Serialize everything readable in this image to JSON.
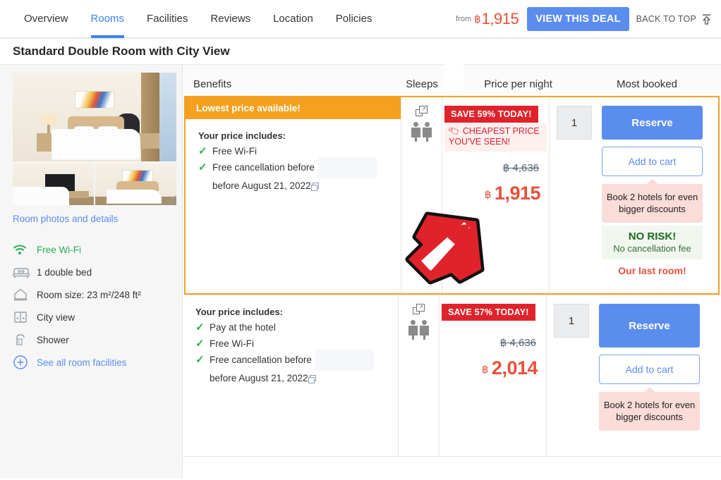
{
  "nav": {
    "tabs": [
      {
        "label": "Overview",
        "active": false
      },
      {
        "label": "Rooms",
        "active": true
      },
      {
        "label": "Facilities",
        "active": false
      },
      {
        "label": "Reviews",
        "active": false
      },
      {
        "label": "Location",
        "active": false
      },
      {
        "label": "Policies",
        "active": false
      }
    ],
    "from_label": "from",
    "currency": "฿",
    "price": "1,915",
    "view_deal_label": "VIEW THIS DEAL",
    "back_to_top_label": "BACK TO TOP",
    "back_to_top_icon": "arrow-up-to-line-icon",
    "accent_color": "#5b8def",
    "price_color": "#e8503a"
  },
  "room": {
    "title": "Standard Double Room with City View",
    "photos_link": "Room photos and details",
    "photos_link_icon": "photo-gallery",
    "facilities": [
      {
        "icon": "wifi-icon",
        "label": "Free Wi-Fi",
        "style": "green"
      },
      {
        "icon": "bed-icon",
        "label": "1 double bed",
        "style": "normal"
      },
      {
        "icon": "room-size-icon",
        "label": "Room size: 23 m²/248 ft²",
        "style": "normal"
      },
      {
        "icon": "window-icon",
        "label": "City view",
        "style": "normal"
      },
      {
        "icon": "shower-icon",
        "label": "Shower",
        "style": "normal"
      },
      {
        "icon": "plus-circle-icon",
        "label": "See all room facilities",
        "style": "link"
      }
    ]
  },
  "table": {
    "headers": {
      "benefits": "Benefits",
      "sleeps": "Sleeps",
      "price_per_night": "Price per night",
      "most_booked": "Most booked"
    },
    "rows": [
      {
        "highlight": true,
        "banner": "Lowest price available!",
        "includes_title": "Your price includes:",
        "includes": [
          "Free Wi-Fi",
          "Free cancellation before"
        ],
        "includes_sub": "before August 21, 2022",
        "sleeps": 2,
        "sleeps_icon": "guests-icon",
        "popup_icon": "open-in-new-window-icon",
        "save_badge": "SAVE 59% TODAY!",
        "cheapest_label": "CHEAPEST PRICE YOU'VE SEEN!",
        "cheapest_icon": "price-tag-icon",
        "old_price": "฿ 4,636",
        "currency": "฿",
        "new_price": "1,915",
        "qty": "1",
        "reserve_label": "Reserve",
        "cart_label": "Add to cart",
        "promo": "Book 2 hotels for even bigger discounts",
        "no_risk_title": "NO RISK!",
        "no_risk_sub": "No cancellation fee",
        "last_room": "Our last room!"
      },
      {
        "highlight": false,
        "banner": "",
        "includes_title": "Your price includes:",
        "includes": [
          "Pay at the hotel",
          "Free Wi-Fi",
          "Free cancellation before"
        ],
        "includes_sub": "before August 21, 2022",
        "sleeps": 2,
        "sleeps_icon": "guests-icon",
        "popup_icon": "open-in-new-window-icon",
        "save_badge": "SAVE 57% TODAY!",
        "cheapest_label": "",
        "old_price": "฿ 4,636",
        "currency": "฿",
        "new_price": "2,014",
        "qty": "1",
        "reserve_label": "Reserve",
        "cart_label": "Add to cart",
        "promo": "Book 2 hotels for even bigger discounts",
        "no_risk_title": "",
        "no_risk_sub": "",
        "last_room": ""
      }
    ]
  },
  "annotation": {
    "type": "cursor-arrow",
    "direction": "up-right",
    "color": "#e0232b"
  }
}
